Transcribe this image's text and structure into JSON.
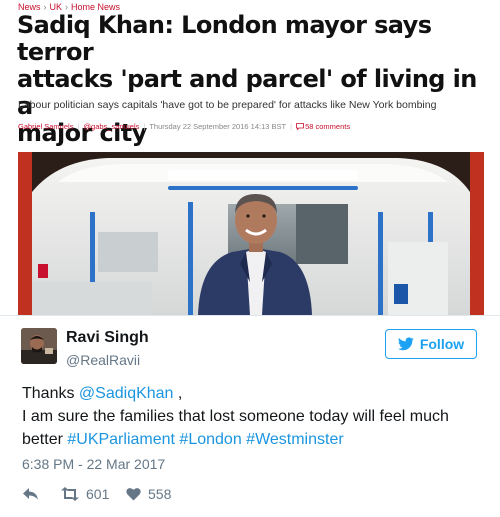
{
  "article": {
    "breadcrumb": {
      "item1": "News",
      "item2": "UK",
      "item3": "Home News",
      "separator": "›"
    },
    "headline_line1": "Sadiq Khan: London mayor says terror",
    "headline_line2": "attacks 'part and parcel' of living in a",
    "headline_line3": "major city",
    "standfirst": "Labour politician says capitals 'have got to be prepared' for attacks like New York bombing",
    "byline": {
      "author": "Gabriel Samuels",
      "handle": "@gabs_samuels",
      "date": "Thursday 22 September 2016 14:13 BST",
      "comments_count": "58",
      "comments_label": "comments"
    }
  },
  "tweet": {
    "name": "Ravi Singh",
    "handle": "@RealRavii",
    "follow_label": "Follow",
    "text_part1": "Thanks ",
    "mention": "@SadiqKhan",
    "text_part2": " ,",
    "text_line2": "I am sure the families that lost someone today will feel much",
    "text_line3_pre": "better ",
    "hashtag1": "#UKParliament",
    "hashtag2": "#London",
    "hashtag3": "#Westminster",
    "timestamp": "6:38 PM - 22 Mar 2017",
    "retweets": "601",
    "likes": "558"
  },
  "colors": {
    "brand_red": "#c8102e",
    "twitter_blue": "#1da1f2",
    "link_blue": "#1b95e0",
    "muted": "#657786"
  },
  "icons": {
    "follow": "twitter-bird-icon",
    "reply": "reply-icon",
    "retweet": "retweet-icon",
    "like": "heart-icon",
    "comments": "speech-bubble-icon"
  }
}
